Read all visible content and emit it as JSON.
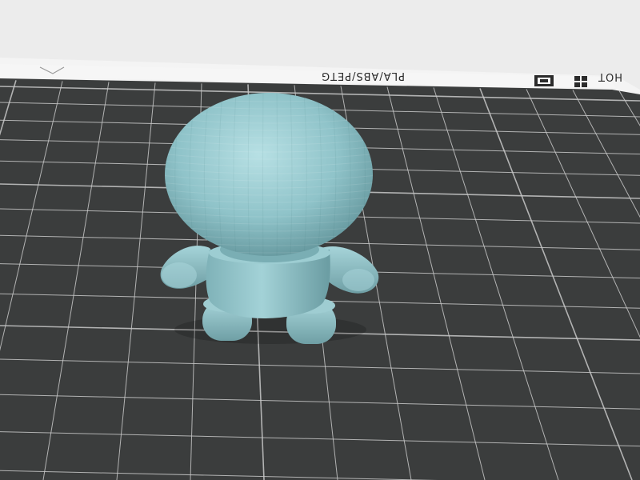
{
  "app": {
    "view": "3d-build-plate-viewport"
  },
  "bed": {
    "label_text": "PLA/ABS/PETG",
    "label_side_text": "HOT",
    "surface_color": "#3b3d3d",
    "grid_color": "#c8c8c8",
    "rim_color": "#f4f4f4",
    "icon_names": [
      "printer-logo-icon",
      "grid-layout-icon"
    ]
  },
  "model": {
    "name": "figurine",
    "color": "#8fc3c9",
    "parts": [
      "head",
      "body",
      "left-arm",
      "right-arm",
      "left-leg",
      "right-leg"
    ]
  }
}
